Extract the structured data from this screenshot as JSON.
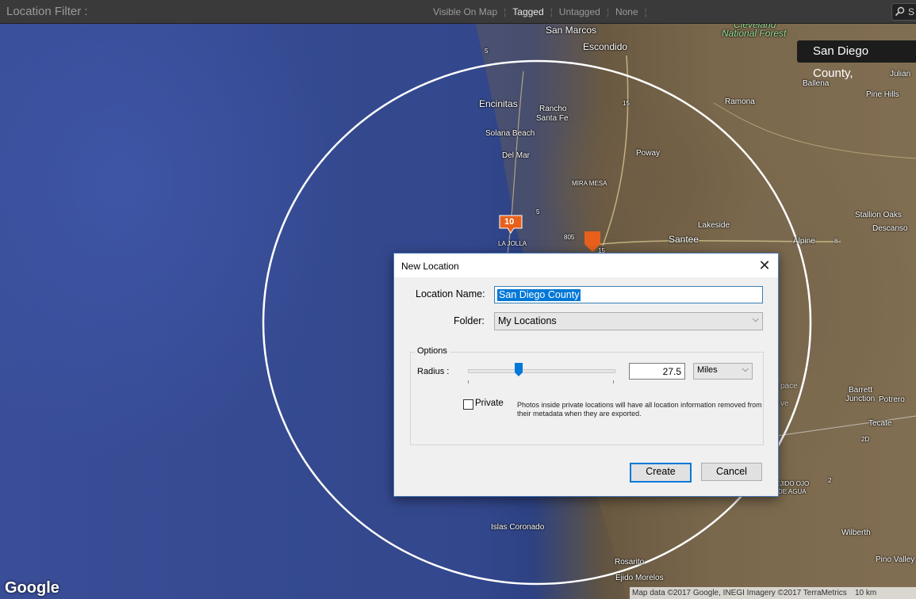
{
  "filter_bar": {
    "label": "Location Filter :",
    "options": [
      {
        "label": "Visible On Map",
        "active": false
      },
      {
        "label": "Tagged",
        "active": true
      },
      {
        "label": "Untagged",
        "active": false
      },
      {
        "label": "None",
        "active": false
      }
    ],
    "search_text": "S"
  },
  "map": {
    "tooltip": "San Diego County,",
    "google_logo": "Google",
    "attribution": "Map data ©2017 Google, INEGI Imagery ©2017 TerraMetrics",
    "scale": "10 km",
    "cluster_marker_count": "10",
    "places": {
      "san_marcos": "San Marcos",
      "escondido": "Escondido",
      "cleveland": "Cleveland",
      "national_forest": "National Forest",
      "ballena": "Ballena",
      "julian": "Julian",
      "pine_hills": "Pine Hills",
      "encinitas": "Encinitas",
      "rancho_santa_fe_1": "Rancho",
      "rancho_santa_fe_2": "Santa Fe",
      "ramona": "Ramona",
      "solana_beach": "Solana Beach",
      "del_mar": "Del Mar",
      "poway": "Poway",
      "mira_mesa": "MIRA MESA",
      "lakeside": "Lakeside",
      "stallion_oaks": "Stallion Oaks",
      "descanso": "Descanso",
      "la_jolla": "LA JOLLA",
      "santee": "Santee",
      "alpine": "Alpine",
      "barrett_junction_1": "Barrett",
      "barrett_junction_2": "Junction",
      "potrero": "Potrero",
      "tecate": "Tecate",
      "ejido": "EJIDO OJO",
      "de_agua": "DE AGUA",
      "islas_coronado": "Islas Coronado",
      "wilberth": "Wilberth",
      "rosarito": "Rosarito",
      "ejido_morelos": "Ejido Morelos",
      "pino_valley": "Pino Valley",
      "i5_a": "5",
      "i5_b": "5",
      "i15_a": "15",
      "i15_b": "15",
      "i805": "805",
      "i8": "8",
      "r2d": "2D",
      "r2": "2",
      "space_1": "pace",
      "space_2": "ve"
    }
  },
  "dialog": {
    "title": "New Location",
    "location_name_label": "Location Name:",
    "location_name_value": "San Diego County",
    "folder_label": "Folder:",
    "folder_value": "My Locations",
    "options_title": "Options",
    "radius_label": "Radius :",
    "radius_value": "27.5",
    "radius_unit": "Miles",
    "private_label": "Private",
    "private_checked": false,
    "private_note": "Photos inside private locations will have all location information removed from their metadata when they are exported.",
    "create_label": "Create",
    "cancel_label": "Cancel"
  },
  "colors": {
    "marker": "#e8601c",
    "selection": "#0078d7"
  }
}
